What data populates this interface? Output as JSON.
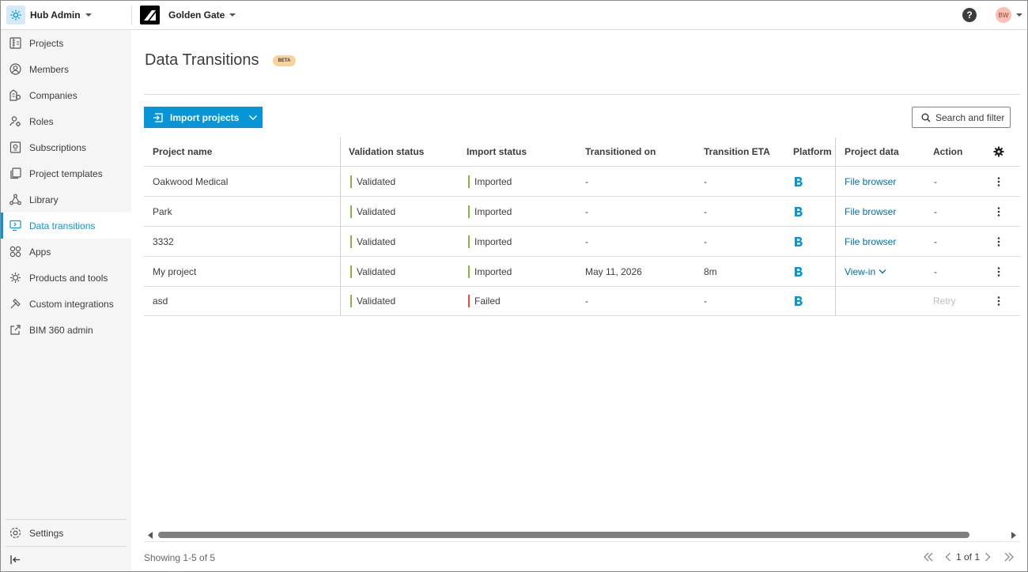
{
  "topbar": {
    "hub_label": "Hub Admin",
    "project_label": "Golden Gate",
    "help_label": "?",
    "avatar_initials": "BW"
  },
  "sidebar": {
    "items": [
      {
        "label": "Projects",
        "icon": "building-icon"
      },
      {
        "label": "Members",
        "icon": "person-icon"
      },
      {
        "label": "Companies",
        "icon": "company-icon"
      },
      {
        "label": "Roles",
        "icon": "roles-icon"
      },
      {
        "label": "Subscriptions",
        "icon": "subscription-icon"
      },
      {
        "label": "Project templates",
        "icon": "templates-icon"
      },
      {
        "label": "Library",
        "icon": "library-icon"
      },
      {
        "label": "Data transitions",
        "icon": "data-transitions-icon",
        "active": true
      },
      {
        "label": "Apps",
        "icon": "apps-icon"
      },
      {
        "label": "Products and tools",
        "icon": "products-icon"
      },
      {
        "label": "Custom integrations",
        "icon": "integrations-icon"
      },
      {
        "label": "BIM 360 admin",
        "icon": "external-link-icon"
      }
    ],
    "settings_label": "Settings"
  },
  "page": {
    "title": "Data Transitions",
    "badge": "BETA",
    "import_button": "Import projects",
    "search_button": "Search and filter"
  },
  "table": {
    "columns": [
      "Project name",
      "Validation status",
      "Import status",
      "Transitioned on",
      "Transition ETA",
      "Platform",
      "Project data",
      "Action"
    ],
    "rows": [
      {
        "name": "Oakwood Medical",
        "validation": "Validated",
        "import": "Imported",
        "import_ok": true,
        "transitioned": "-",
        "eta": "-",
        "platform": "B",
        "data": "File browser",
        "data_dropdown": false,
        "action": "-"
      },
      {
        "name": "Park",
        "validation": "Validated",
        "import": "Imported",
        "import_ok": true,
        "transitioned": "-",
        "eta": "-",
        "platform": "B",
        "data": "File browser",
        "data_dropdown": false,
        "action": "-"
      },
      {
        "name": "3332",
        "validation": "Validated",
        "import": "Imported",
        "import_ok": true,
        "transitioned": "-",
        "eta": "-",
        "platform": "B",
        "data": "File browser",
        "data_dropdown": false,
        "action": "-"
      },
      {
        "name": "My project",
        "validation": "Validated",
        "import": "Imported",
        "import_ok": true,
        "transitioned": "May 11, 2026",
        "eta": "8m",
        "platform": "B",
        "data": "View-in",
        "data_dropdown": true,
        "action": "-"
      },
      {
        "name": "asd",
        "validation": "Validated",
        "import": "Failed",
        "import_ok": false,
        "transitioned": "-",
        "eta": "-",
        "platform": "B",
        "data": "",
        "data_dropdown": false,
        "action": "Retry"
      }
    ]
  },
  "footer": {
    "showing": "Showing 1-5 of 5",
    "page_label": "1 of 1"
  },
  "colors": {
    "accent": "#0696d7",
    "link": "#006eaf",
    "status_ok": "#87b340",
    "status_failed": "#eb4b38",
    "beta_badge": "#f7d29b"
  }
}
